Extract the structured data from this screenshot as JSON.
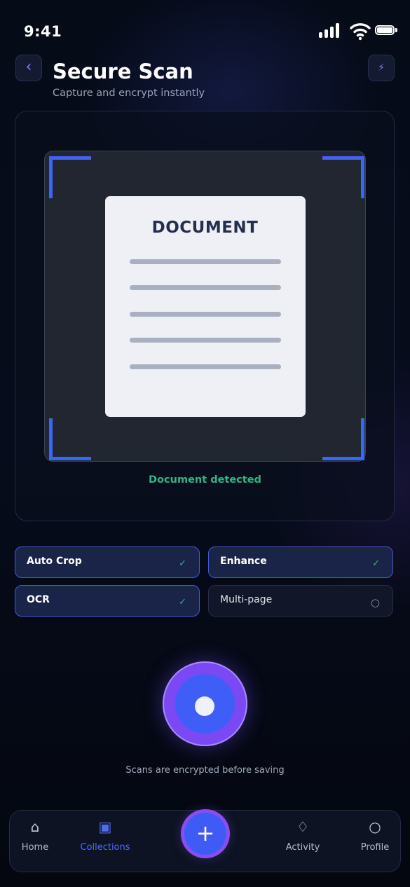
{
  "status_bar": {
    "time": "9:41"
  },
  "header": {
    "title": "Secure Scan",
    "subtitle": "Capture and encrypt instantly",
    "back_icon": "chevron-left-icon",
    "flash_icon": "lightning-icon",
    "back_glyph": "‹",
    "flash_glyph": "⚡"
  },
  "scanner": {
    "document_title": "DOCUMENT",
    "status": "Document detected",
    "status_color": "#2fb67f",
    "frame_color": "#3f63f4"
  },
  "options": [
    {
      "label": "Auto Crop",
      "enabled": true,
      "mark": "✓"
    },
    {
      "label": "Enhance",
      "enabled": true,
      "mark": "✓"
    },
    {
      "label": "OCR",
      "enabled": true,
      "mark": "✓"
    },
    {
      "label": "Multi-page",
      "enabled": false,
      "mark": "○"
    }
  ],
  "capture": {
    "note": "Scans are encrypted before saving"
  },
  "nav": {
    "items": [
      {
        "label": "Home",
        "icon": "home-icon",
        "glyph": "⌂",
        "active": false
      },
      {
        "label": "Collections",
        "icon": "collections-icon",
        "glyph": "▣",
        "active": true
      },
      {
        "label": "Activity",
        "icon": "activity-icon",
        "glyph": "♢",
        "active": false
      },
      {
        "label": "Profile",
        "icon": "profile-icon",
        "glyph": "○",
        "active": false
      }
    ],
    "add_glyph": "+"
  },
  "colors": {
    "accent": "#3f5ef8",
    "accent_purple": "#7b49f3",
    "background": "#060b18"
  }
}
